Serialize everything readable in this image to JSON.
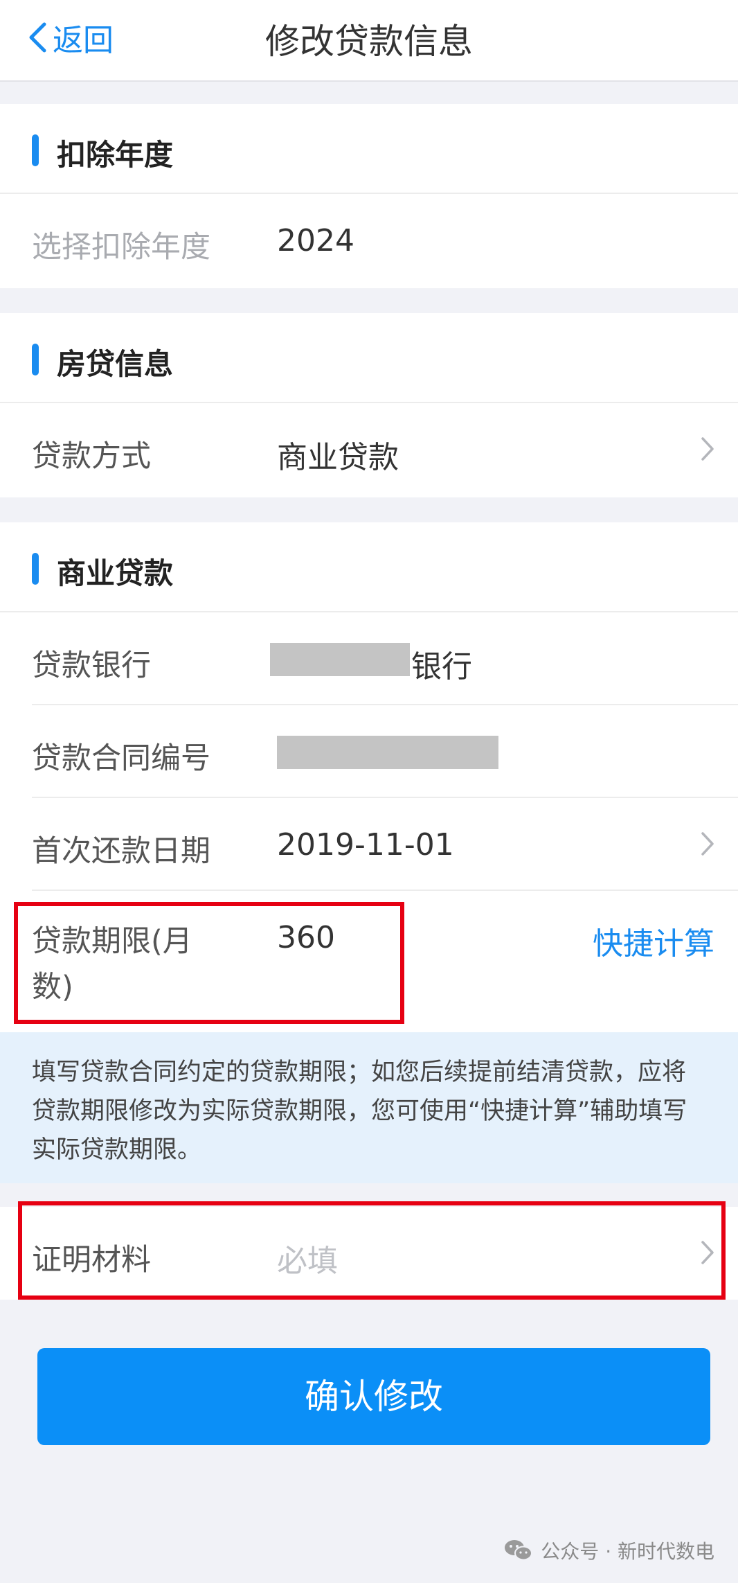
{
  "nav": {
    "back_label": "返回",
    "title": "修改贷款信息"
  },
  "deduction_section": {
    "title": "扣除年度",
    "year_label": "选择扣除年度",
    "year_value": "2024"
  },
  "mortgage_section": {
    "title": "房贷信息",
    "loan_type_label": "贷款方式",
    "loan_type_value": "商业贷款"
  },
  "commercial_section": {
    "title": "商业贷款",
    "bank_label": "贷款银行",
    "bank_value_suffix": "银行",
    "contract_label": "贷款合同编号",
    "first_repay_label": "首次还款日期",
    "first_repay_value": "2019-11-01",
    "term_label": "贷款期限(月数)",
    "term_value": "360",
    "quick_calc_label": "快捷计算"
  },
  "hint": {
    "text": "填写贷款合同约定的贷款期限；如您后续提前结清贷款，应将贷款期限修改为实际贷款期限，您可使用“快捷计算”辅助填写实际贷款期限。"
  },
  "proof": {
    "label": "证明材料",
    "placeholder": "必填"
  },
  "confirm_button_label": "确认修改",
  "footer": {
    "watermark": "公众号 · 新时代数电"
  },
  "icons": {
    "back": "chevron-left-icon",
    "row_arrow": "chevron-right-icon",
    "watermark": "wechat-icon"
  },
  "colors": {
    "accent": "#1a8cf0",
    "button": "#0b8ff7",
    "highlight_box": "#e60012",
    "hint_background": "#e5f1fc",
    "page_background": "#f1f2f7"
  }
}
